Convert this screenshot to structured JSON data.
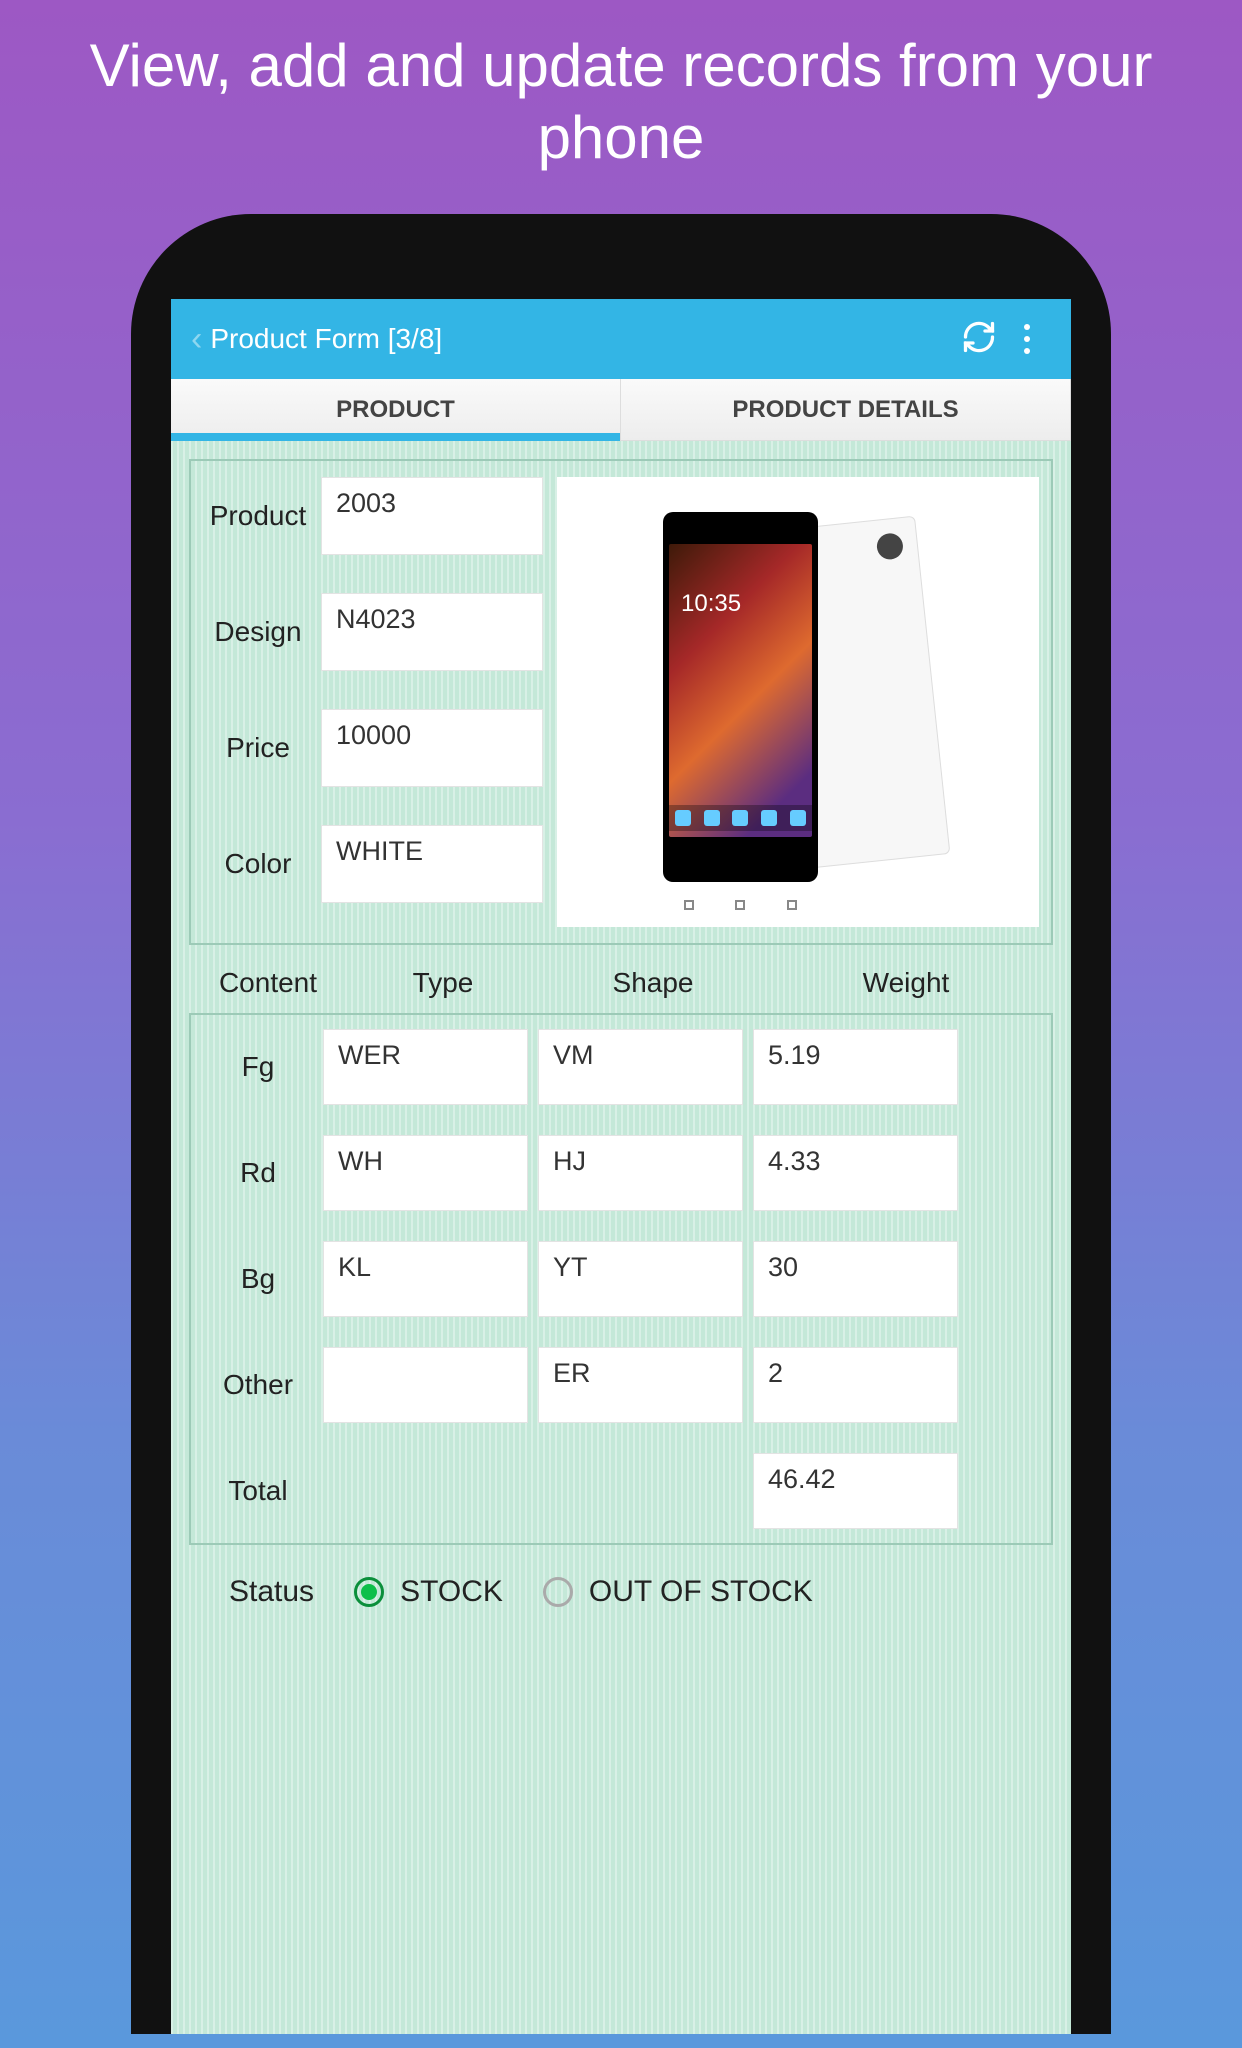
{
  "marketing_headline": "View, add and update records from your phone",
  "header": {
    "title": "Product Form [3/8]",
    "refresh_icon": "refresh",
    "more_icon": "more-vert"
  },
  "tabs": [
    {
      "label": "PRODUCT",
      "active": true
    },
    {
      "label": "PRODUCT DETAILS",
      "active": false
    }
  ],
  "fields": {
    "product": {
      "label": "Product",
      "value": "2003"
    },
    "design": {
      "label": "Design",
      "value": "N4023"
    },
    "price": {
      "label": "Price",
      "value": "10000"
    },
    "color": {
      "label": "Color",
      "value": "WHITE"
    }
  },
  "image_clock": "10:35",
  "columns": {
    "content": "Content",
    "type": "Type",
    "shape": "Shape",
    "weight": "Weight"
  },
  "rows": [
    {
      "label": "Fg",
      "type": "WER",
      "shape": "VM",
      "weight": "5.19"
    },
    {
      "label": "Rd",
      "type": "WH",
      "shape": "HJ",
      "weight": "4.33"
    },
    {
      "label": "Bg",
      "type": "KL",
      "shape": "YT",
      "weight": "30"
    },
    {
      "label": "Other",
      "type": "",
      "shape": "ER",
      "weight": "2"
    }
  ],
  "total": {
    "label": "Total",
    "value": "46.42"
  },
  "status": {
    "label": "Status",
    "options": [
      {
        "label": "STOCK",
        "checked": true
      },
      {
        "label": "OUT OF STOCK",
        "checked": false
      }
    ]
  }
}
